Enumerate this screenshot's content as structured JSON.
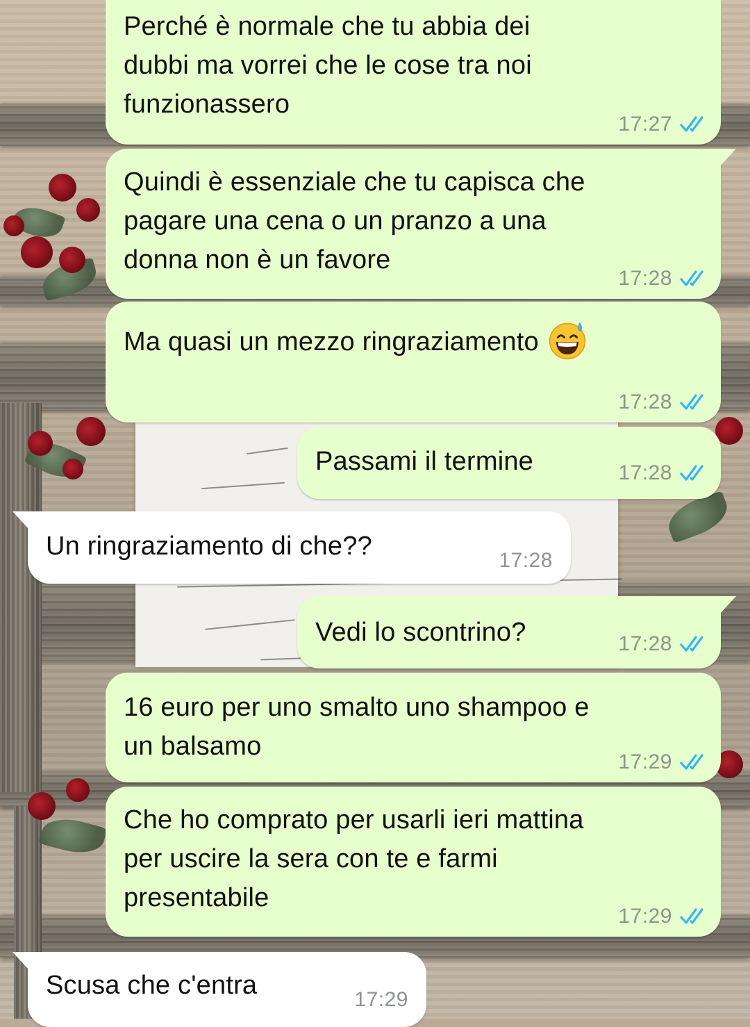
{
  "chat": {
    "colors": {
      "outgoing_bubble": "#e6ffcd",
      "incoming_bubble": "#ffffff",
      "read_ticks": "#34b7f1",
      "time_text": "#8c958a"
    },
    "messages": [
      {
        "direction": "outgoing",
        "text": "Perché è normale che tu abbia dei\ndubbi ma vorrei che le cose tra noi\nfunzionassero",
        "time": "17:27",
        "status": "read",
        "status_icon": "double-check-icon"
      },
      {
        "direction": "outgoing",
        "text": "Quindi è essenziale che tu capisca che\npagare una cena o un pranzo a una\ndonna non è un favore",
        "time": "17:28",
        "status": "read",
        "status_icon": "double-check-icon"
      },
      {
        "direction": "outgoing",
        "text": "Ma quasi un mezzo ringraziamento",
        "emoji": "grinning-face-with-sweat",
        "time": "17:28",
        "status": "read",
        "status_icon": "double-check-icon"
      },
      {
        "direction": "outgoing",
        "text": "Passami il termine",
        "time": "17:28",
        "status": "read",
        "status_icon": "double-check-icon"
      },
      {
        "direction": "incoming",
        "text": "Un ringraziamento di che??",
        "time": "17:28"
      },
      {
        "direction": "outgoing",
        "text": "Vedi lo scontrino?",
        "time": "17:28",
        "status": "read",
        "status_icon": "double-check-icon"
      },
      {
        "direction": "outgoing",
        "text": "16 euro per uno smalto uno shampoo e\nun balsamo",
        "time": "17:29",
        "status": "read",
        "status_icon": "double-check-icon"
      },
      {
        "direction": "outgoing",
        "text": "Che ho comprato per usarli ieri mattina\nper uscire la sera con te e farmi\npresentabile",
        "time": "17:29",
        "status": "read",
        "status_icon": "double-check-icon"
      },
      {
        "direction": "incoming",
        "text": "Scusa che c'entra",
        "time": "17:29"
      }
    ]
  }
}
